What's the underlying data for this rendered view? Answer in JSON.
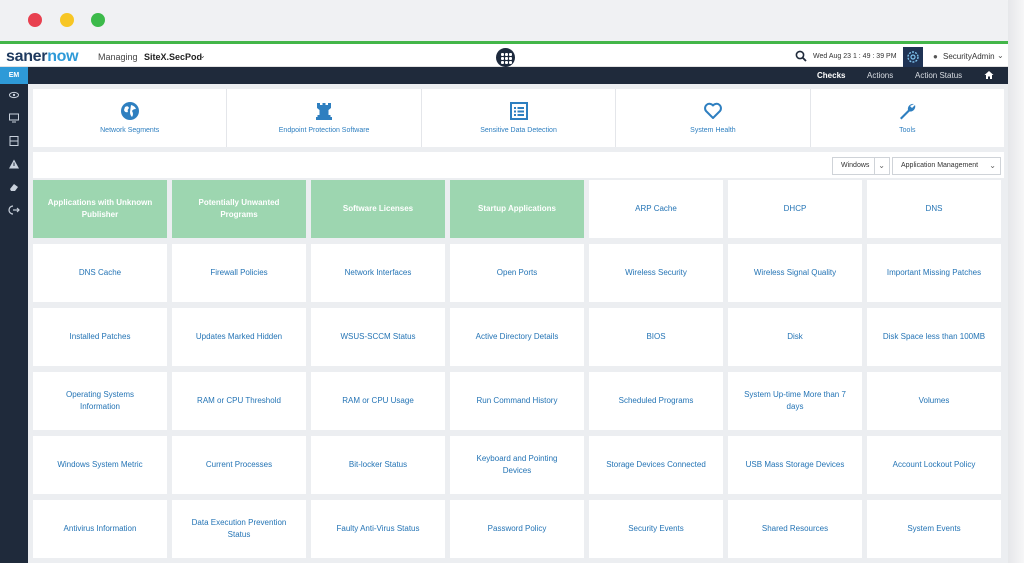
{
  "header": {
    "logo_part1": "saner",
    "logo_part2": "now",
    "managing_label": "Managing",
    "site_name": "SiteX.SecPod",
    "datetime": "Wed Aug 23  1 : 49 : 39 PM",
    "user": "SecurityAdmin"
  },
  "nav": {
    "items": [
      "Checks",
      "Actions",
      "Action Status"
    ],
    "active": "Checks"
  },
  "sidebar": {
    "badge": "EM",
    "icons": [
      "eye-icon",
      "monitor-icon",
      "server-icon",
      "warning-icon",
      "eraser-icon",
      "logout-icon"
    ]
  },
  "categories": [
    {
      "label": "Network Segments",
      "icon": "globe-icon"
    },
    {
      "label": "Endpoint Protection Software",
      "icon": "rook-icon"
    },
    {
      "label": "Sensitive Data Detection",
      "icon": "list-icon"
    },
    {
      "label": "System Health",
      "icon": "heart-icon"
    },
    {
      "label": "Tools",
      "icon": "wrench-icon"
    }
  ],
  "filters": {
    "os": "Windows",
    "category": "Application Management"
  },
  "tiles": [
    {
      "label": "Applications with Unknown Publisher",
      "active": true
    },
    {
      "label": "Potentially Unwanted Programs",
      "active": true
    },
    {
      "label": "Software Licenses",
      "active": true
    },
    {
      "label": "Startup Applications",
      "active": true
    },
    {
      "label": "ARP Cache",
      "active": false
    },
    {
      "label": "DHCP",
      "active": false
    },
    {
      "label": "DNS",
      "active": false
    },
    {
      "label": "DNS Cache",
      "active": false
    },
    {
      "label": "Firewall Policies",
      "active": false
    },
    {
      "label": "Network Interfaces",
      "active": false
    },
    {
      "label": "Open Ports",
      "active": false
    },
    {
      "label": "Wireless Security",
      "active": false
    },
    {
      "label": "Wireless Signal Quality",
      "active": false
    },
    {
      "label": "Important Missing Patches",
      "active": false
    },
    {
      "label": "Installed Patches",
      "active": false
    },
    {
      "label": "Updates Marked Hidden",
      "active": false
    },
    {
      "label": "WSUS-SCCM Status",
      "active": false
    },
    {
      "label": "Active Directory Details",
      "active": false
    },
    {
      "label": "BIOS",
      "active": false
    },
    {
      "label": "Disk",
      "active": false
    },
    {
      "label": "Disk Space less than 100MB",
      "active": false
    },
    {
      "label": "Operating Systems Information",
      "active": false
    },
    {
      "label": "RAM or CPU Threshold",
      "active": false
    },
    {
      "label": "RAM or CPU Usage",
      "active": false
    },
    {
      "label": "Run Command History",
      "active": false
    },
    {
      "label": "Scheduled Programs",
      "active": false
    },
    {
      "label": "System Up-time More than 7 days",
      "active": false
    },
    {
      "label": "Volumes",
      "active": false
    },
    {
      "label": "Windows System Metric",
      "active": false
    },
    {
      "label": "Current Processes",
      "active": false
    },
    {
      "label": "Bit-locker Status",
      "active": false
    },
    {
      "label": "Keyboard and Pointing Devices",
      "active": false
    },
    {
      "label": "Storage Devices Connected",
      "active": false
    },
    {
      "label": "USB Mass Storage Devices",
      "active": false
    },
    {
      "label": "Account Lockout Policy",
      "active": false
    },
    {
      "label": "Antivirus Information",
      "active": false
    },
    {
      "label": "Data Execution Prevention Status",
      "active": false
    },
    {
      "label": "Faulty Anti-Virus Status",
      "active": false
    },
    {
      "label": "Password Policy",
      "active": false
    },
    {
      "label": "Security Events",
      "active": false
    },
    {
      "label": "Shared Resources",
      "active": false
    },
    {
      "label": "System Events",
      "active": false
    }
  ],
  "colors": {
    "accent": "#2e9ad8",
    "active_tile": "#9dd6b0",
    "nav_bg": "#1f2a3b",
    "tile_text": "#2474b5"
  }
}
